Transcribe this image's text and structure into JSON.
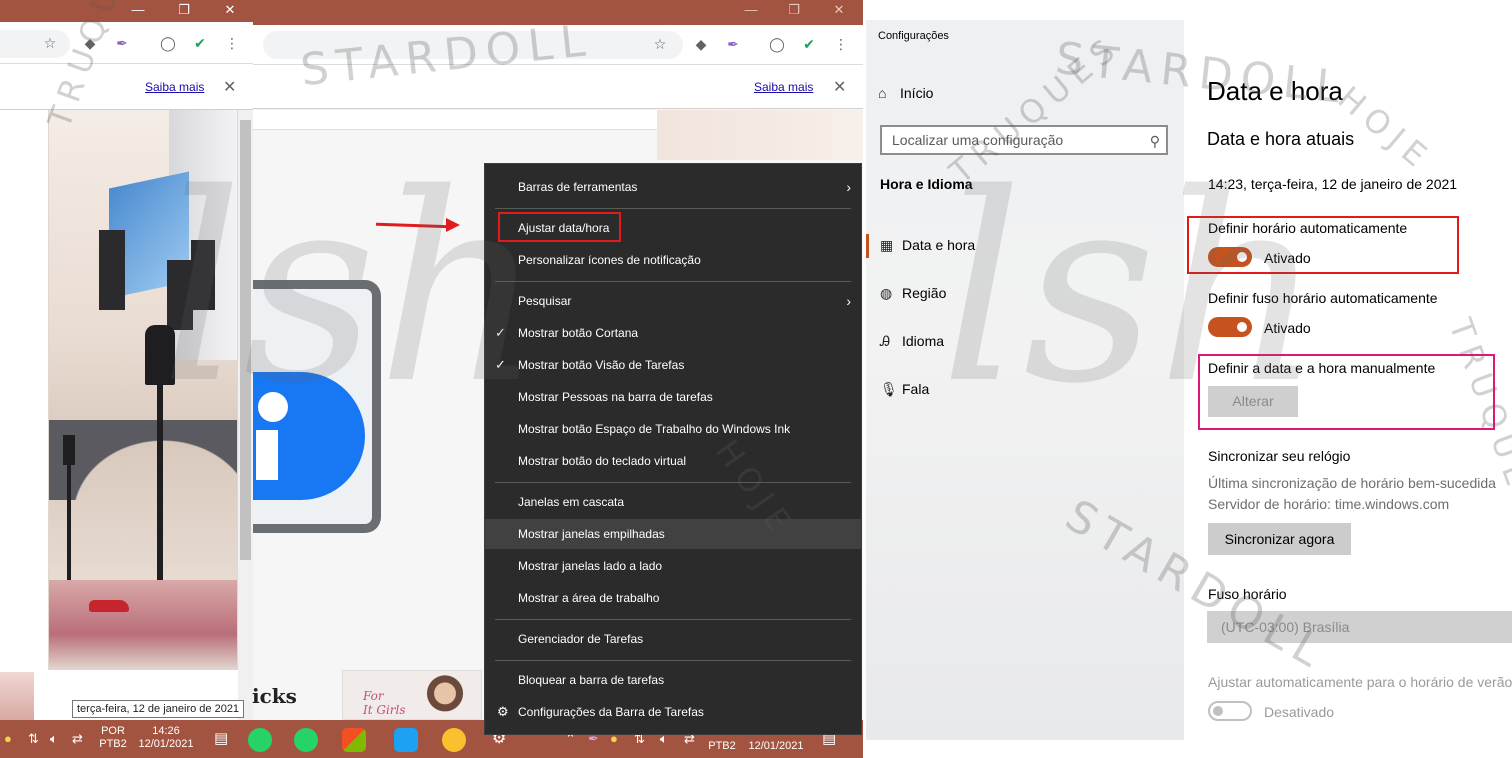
{
  "left_browser": {
    "infobar_link": "Saiba mais",
    "date_tooltip": "terça-feira, 12 de janeiro de 2021",
    "thumb_text_for": "For",
    "thumb_text_girls": "It Girls",
    "partial_text": "icks"
  },
  "middle_browser": {
    "infobar_link": "Saiba mais"
  },
  "taskbar_left": {
    "lang_top": "POR",
    "lang_bottom": "PTB2",
    "time": "14:26",
    "date": "12/01/2021"
  },
  "taskbar_mid": {
    "lang_bottom": "PTB2",
    "date": "12/01/2021"
  },
  "context_menu": {
    "items": [
      {
        "label": "Barras de ferramentas"
      },
      {
        "label": "Ajustar data/hora"
      },
      {
        "label": "Personalizar ícones de notificação"
      },
      {
        "label": "Pesquisar"
      },
      {
        "label": "Mostrar botão Cortana"
      },
      {
        "label": "Mostrar botão Visão de Tarefas"
      },
      {
        "label": "Mostrar Pessoas na barra de tarefas"
      },
      {
        "label": "Mostrar botão Espaço de Trabalho do Windows Ink"
      },
      {
        "label": "Mostrar botão do teclado virtual"
      },
      {
        "label": "Janelas em cascata"
      },
      {
        "label": "Mostrar janelas empilhadas"
      },
      {
        "label": "Mostrar janelas lado a lado"
      },
      {
        "label": "Mostrar a área de trabalho"
      },
      {
        "label": "Gerenciador de Tarefas"
      },
      {
        "label": "Bloquear a barra de tarefas"
      },
      {
        "label": "Configurações da Barra de Tarefas"
      }
    ]
  },
  "settings": {
    "window_title": "Configurações",
    "nav_home": "Início",
    "search_placeholder": "Localizar uma configuração",
    "section": "Hora e Idioma",
    "nav": [
      {
        "label": "Data e hora"
      },
      {
        "label": "Região"
      },
      {
        "label": "Idioma"
      },
      {
        "label": "Fala"
      }
    ],
    "page_title": "Data e hora",
    "subtitle": "Data e hora atuais",
    "current_datetime": "14:23, terça-feira, 12 de janeiro de 2021",
    "auto_time_label": "Definir horário automaticamente",
    "auto_time_state": "Ativado",
    "auto_tz_label": "Definir fuso horário automaticamente",
    "auto_tz_state": "Ativado",
    "manual_label": "Definir a data e a hora manualmente",
    "manual_button": "Alterar",
    "sync_title": "Sincronizar seu relógio",
    "sync_last": "Última sincronização de horário bem-sucedida",
    "sync_server": "Servidor de horário: time.windows.com",
    "sync_button": "Sincronizar agora",
    "tz_label": "Fuso horário",
    "tz_value": "(UTC-03:00) Brasília",
    "dst_label": "Ajustar automaticamente para o horário de verão",
    "dst_state": "Desativado"
  },
  "watermark": {
    "text_top": "STARDOLL",
    "text_side": "TRUQUES",
    "text_hoje": "HOJE",
    "script": "lsh"
  },
  "colors": {
    "taskbar": "#a35440",
    "accent": "#c6531f",
    "highlight_red": "#e11a1a",
    "highlight_pink": "#e0167a"
  }
}
